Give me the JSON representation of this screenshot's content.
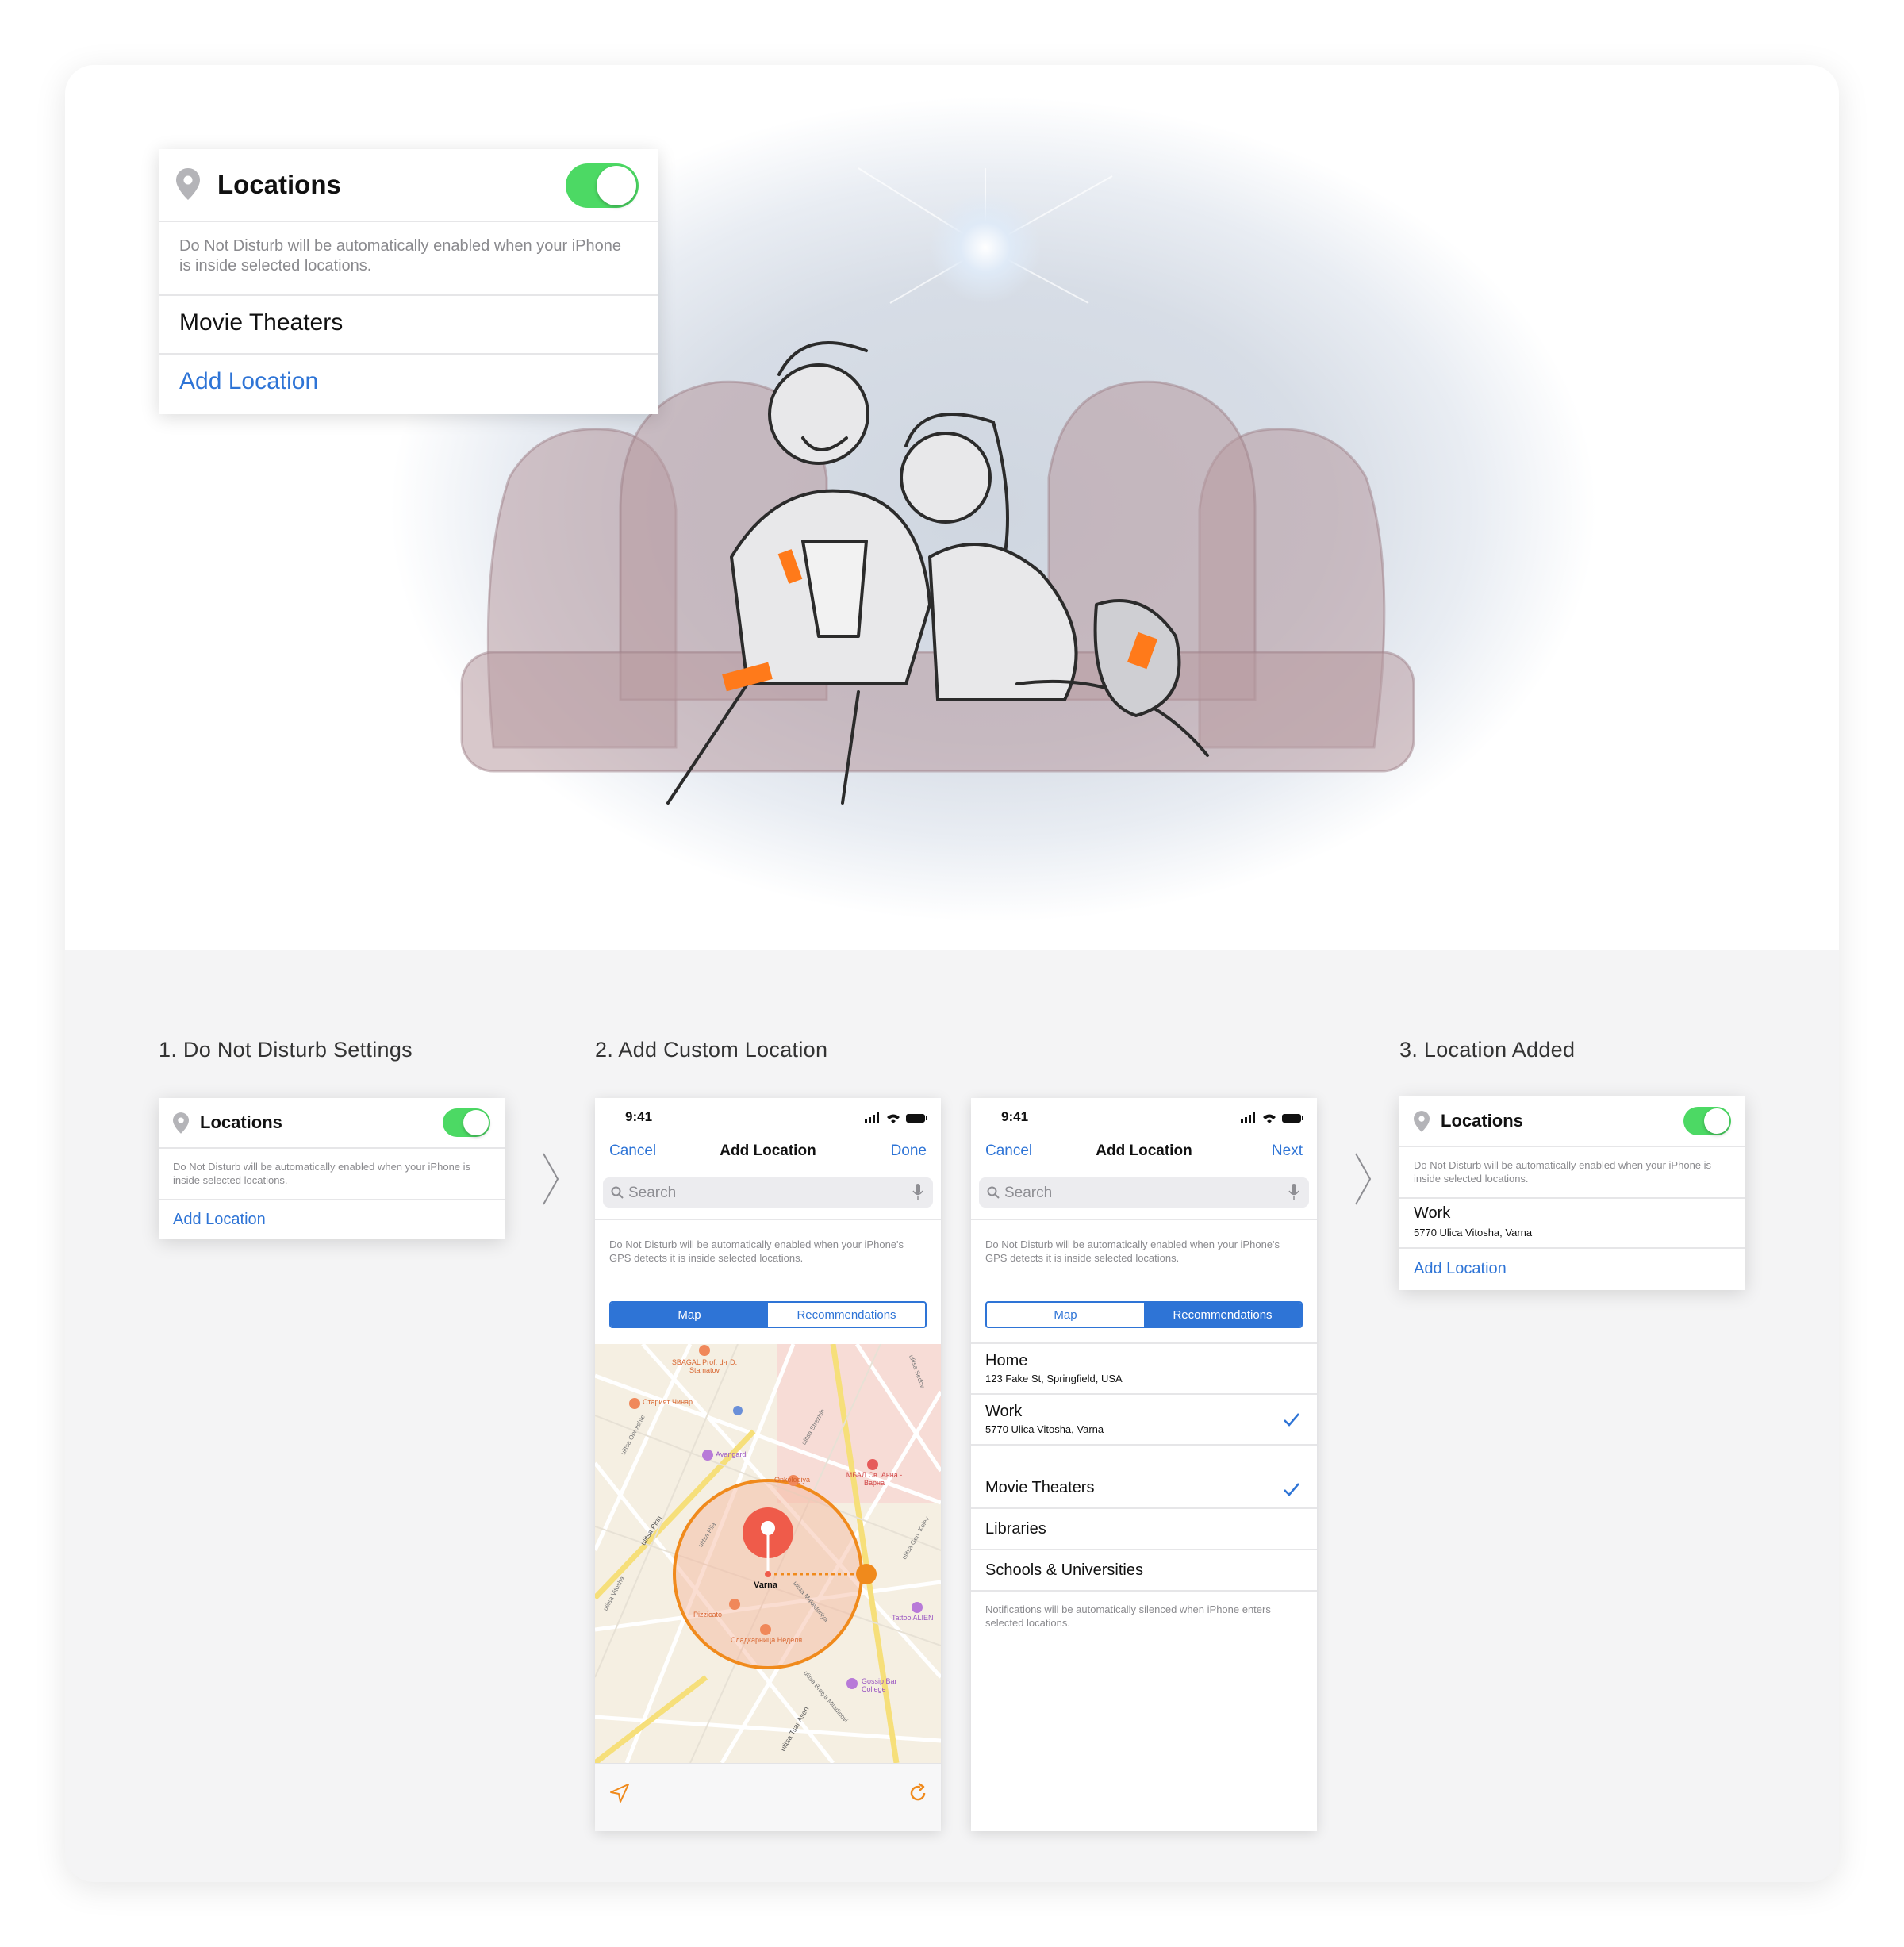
{
  "hero": {
    "card": {
      "title": "Locations",
      "toggle_on": true,
      "description": "Do Not Disturb will be automatically enabled when your iPhone is inside selected locations.",
      "item": "Movie Theaters",
      "add_link": "Add Location"
    }
  },
  "steps": {
    "step1": {
      "title": "1. Do Not Disturb Settings",
      "card_title": "Locations",
      "toggle_on": true,
      "description": "Do Not Disturb will be automatically enabled when your iPhone is inside selected locations.",
      "add_link": "Add Location"
    },
    "step2": {
      "title": "2. Add Custom Location",
      "map_screen": {
        "time": "9:41",
        "cancel": "Cancel",
        "nav_title": "Add Location",
        "done": "Done",
        "search_placeholder": "Search",
        "note": "Do Not Disturb will be automatically enabled when your iPhone's GPS detects it is inside selected locations.",
        "seg_map": "Map",
        "seg_recommendations": "Recommendations",
        "selected_segment": "Map",
        "map_labels": {
          "pin_label": "Varna",
          "poi_1": "SBAGAL Prof. d-r D. Stamatov",
          "poi_2": "Старият Чинар",
          "poi_3": "Avangard",
          "poi_4": "Onkologiya",
          "poi_5": "МБАЛ Св. Анна - Варна",
          "poi_6": "Pizzicato",
          "poi_7": "Сладкарница Неделя",
          "poi_8": "Tattoo ALIEN",
          "poi_9": "Gossip Bar College",
          "street_1": "ulitsa Pirin",
          "street_2": "ulitsa Tsar Asen",
          "street_3": "ulitsa Makedoniya",
          "street_4": "ulitsa Vitosha",
          "street_5": "ulitsa Strezhin",
          "street_6": "ulitsa Sedov",
          "street_7": "ulitsa Obroishte",
          "street_8": "ulitsa Rila",
          "street_9": "ulitsa Bratya Miladinovi",
          "street_10": "ulitsa Gen. Kolev"
        }
      },
      "list_screen": {
        "time": "9:41",
        "cancel": "Cancel",
        "nav_title": "Add Location",
        "next": "Next",
        "search_placeholder": "Search",
        "note": "Do Not Disturb will be automatically enabled when your iPhone's GPS detects it is inside selected locations.",
        "seg_map": "Map",
        "seg_recommendations": "Recommendations",
        "selected_segment": "Recommendations",
        "places": [
          {
            "name": "Home",
            "address": "123 Fake St, Springfield, USA",
            "checked": false
          },
          {
            "name": "Work",
            "address": "5770 Ulica Vitosha, Varna",
            "checked": true
          }
        ],
        "categories": [
          {
            "name": "Movie Theaters",
            "checked": true
          },
          {
            "name": "Libraries",
            "checked": false
          },
          {
            "name": "Schools & Universities",
            "checked": false
          }
        ],
        "footer_note": "Notifications will be automatically silenced when iPhone enters selected locations."
      }
    },
    "step3": {
      "title": "3. Location Added",
      "card_title": "Locations",
      "toggle_on": true,
      "description": "Do Not Disturb will be automatically enabled when your iPhone is inside selected locations.",
      "location_name": "Work",
      "location_address": "5770 Ulica Vitosha, Varna",
      "add_link": "Add Location"
    }
  },
  "colors": {
    "accent_blue": "#2e74d6",
    "toggle_green": "#4cd964",
    "map_orange": "#f08a1c",
    "pin_red": "#ef5b4a"
  }
}
